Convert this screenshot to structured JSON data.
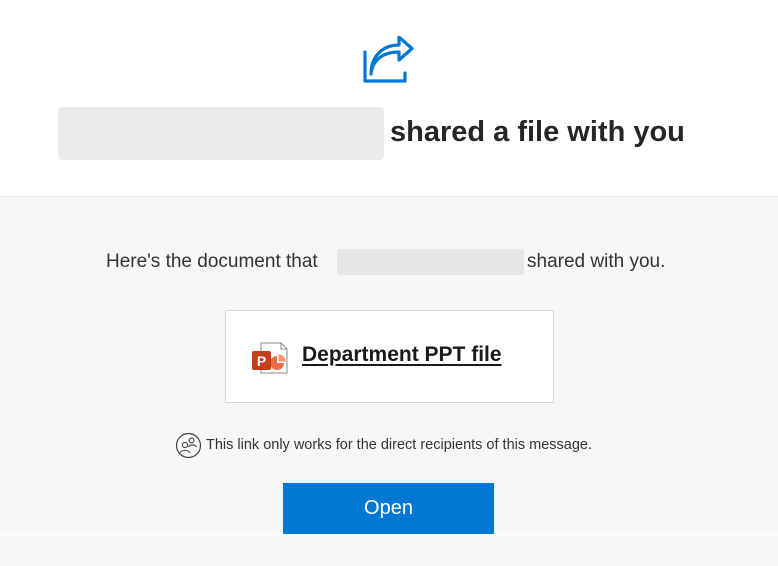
{
  "header": {
    "icon": "share-arrow-icon",
    "headline": "shared a file with you"
  },
  "message": {
    "prefix": "Here's the document that",
    "suffix": "shared with you."
  },
  "file": {
    "icon": "powerpoint-icon",
    "name": "Department PPT file"
  },
  "notice": {
    "icon": "people-icon",
    "text": "This link only works for the direct recipients of this message."
  },
  "actions": {
    "open_label": "Open"
  },
  "colors": {
    "accent": "#0078d4",
    "powerpoint": "#d04423"
  }
}
